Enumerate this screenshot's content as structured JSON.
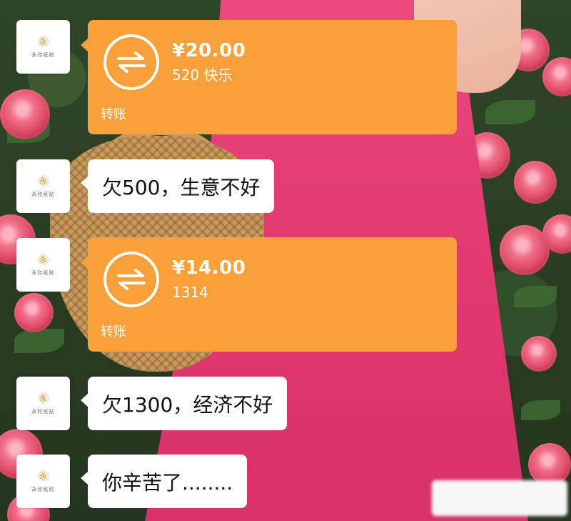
{
  "colors": {
    "transfer_bg": "#f8a039",
    "bubble_bg": "#ffffff",
    "text_dark": "#111111",
    "dress_pink": "#e23c73"
  },
  "messages": [
    {
      "type": "transfer",
      "amount": "¥20.00",
      "note": "520 快乐",
      "label": "转账",
      "icon": "transfer-arrows-icon"
    },
    {
      "type": "text",
      "text": "欠500，生意不好"
    },
    {
      "type": "transfer",
      "amount": "¥14.00",
      "note": "1314",
      "label": "转账",
      "icon": "transfer-arrows-icon"
    },
    {
      "type": "text",
      "text": "欠1300，经济不好"
    },
    {
      "type": "text",
      "text": "你辛苦了........"
    }
  ],
  "avatar": {
    "mark": "永",
    "caption": "永欣纸贴"
  }
}
